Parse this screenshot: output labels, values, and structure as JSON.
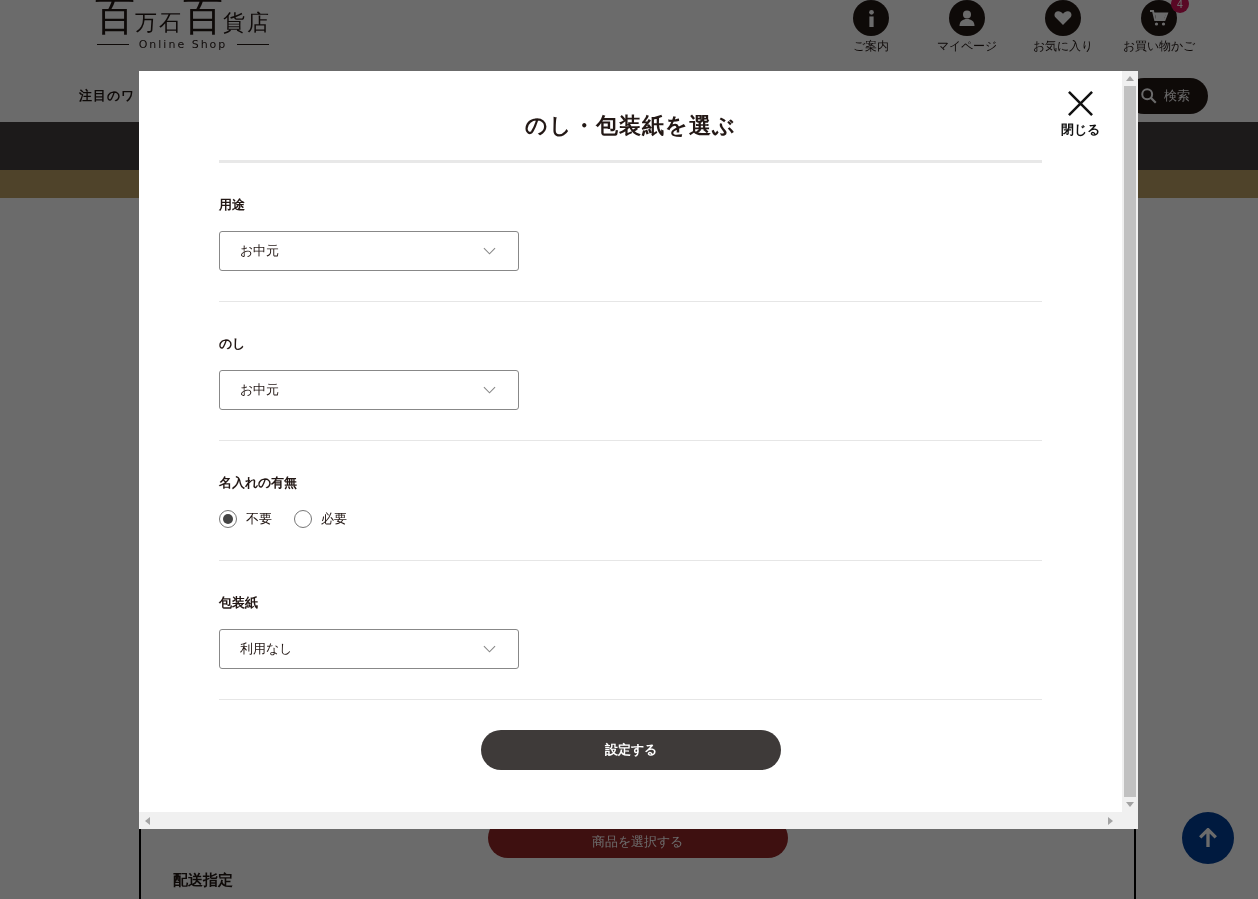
{
  "header": {
    "logo": {
      "parts": [
        "百",
        "万石",
        "百",
        "貨店"
      ],
      "tagline": "Online Shop"
    },
    "nav_icons": [
      {
        "kind": "info",
        "label": "ご案内"
      },
      {
        "kind": "person",
        "label": "マイページ"
      },
      {
        "kind": "heart",
        "label": "お気に入り"
      },
      {
        "kind": "cart",
        "label": "お買い物かご",
        "badge": "4"
      }
    ],
    "keyword_label": "注目のワ",
    "search_button": "検索"
  },
  "page": {
    "select_products_button": "商品を選択する",
    "section_heading": "配送指定"
  },
  "modal": {
    "title": "のし・包装紙を選ぶ",
    "close_label": "閉じる",
    "sections": [
      {
        "kind": "select",
        "label": "用途",
        "value": "お中元"
      },
      {
        "kind": "select",
        "label": "のし",
        "value": "お中元"
      },
      {
        "kind": "radio",
        "label": "名入れの有無",
        "options": [
          {
            "label": "不要",
            "selected": true
          },
          {
            "label": "必要",
            "selected": false
          }
        ]
      },
      {
        "kind": "select",
        "label": "包装紙",
        "value": "利用なし"
      }
    ],
    "submit_button": "設定する"
  }
}
